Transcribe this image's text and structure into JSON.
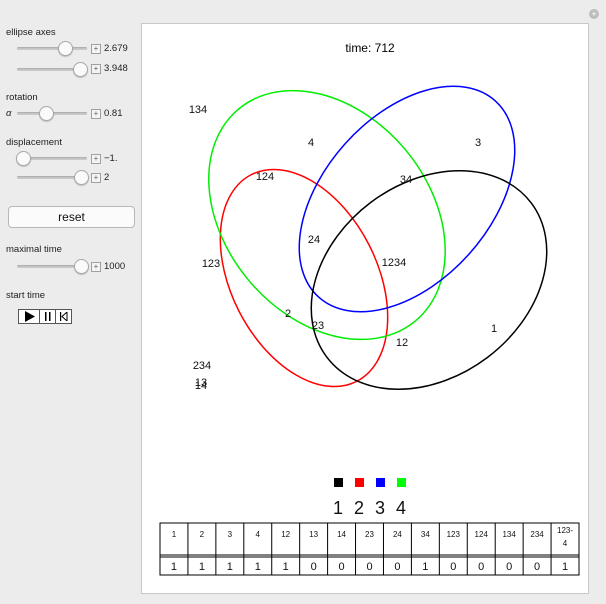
{
  "controls": {
    "ellipse_axes_label": "ellipse axes",
    "ellipse_axis_1": {
      "value": "2.679",
      "fraction": 0.8
    },
    "ellipse_axis_2": {
      "value": "3.948",
      "fraction": 0.95
    },
    "rotation_label": "rotation",
    "alpha_label": "α",
    "rotation": {
      "value": "0.81",
      "fraction": 0.38
    },
    "displacement_label": "displacement",
    "displacement_1": {
      "value": "−1.",
      "fraction": 0.05
    },
    "displacement_2": {
      "value": "2",
      "fraction": 0.95
    },
    "reset_label": "reset",
    "maximal_time_label": "maximal time",
    "maximal_time": {
      "value": "1000",
      "fraction": 0.95
    },
    "start_time_label": "start time"
  },
  "plot": {
    "time_text": "time: 712",
    "colors": {
      "set1": "#000000",
      "set2": "#ff0000",
      "set3": "#0000ff",
      "set4": "#00ff00"
    },
    "region_labels": {
      "r134": "134",
      "r4": "4",
      "r3": "3",
      "r124": "124",
      "r34": "34",
      "r24": "24",
      "r123": "123",
      "r1234": "1234",
      "r2": "2",
      "r23": "23",
      "r12": "12",
      "r1": "1",
      "r234": "234",
      "r13": "13",
      "r14": "14"
    },
    "legend": [
      "1",
      "2",
      "3",
      "4"
    ]
  },
  "table": {
    "headers": [
      "1",
      "2",
      "3",
      "4",
      "12",
      "13",
      "14",
      "23",
      "24",
      "34",
      "123",
      "124",
      "134",
      "234",
      "123-4"
    ],
    "values": [
      "1",
      "1",
      "1",
      "1",
      "1",
      "0",
      "0",
      "0",
      "0",
      "1",
      "0",
      "0",
      "0",
      "0",
      "1"
    ]
  }
}
